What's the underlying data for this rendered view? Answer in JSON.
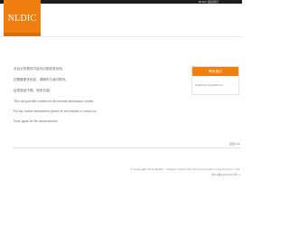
{
  "header": {
    "logo_text": "NLDIC",
    "top_link": "NLDIC 联系我们"
  },
  "messages": [
    "本站点的是供内容为内部信息系统。",
    "如需要更多信息，请随时与我们联系。",
    "给您造成不便，请多包涵！",
    "This site provides content for the internal information system.",
    "For any further information, please do not hesitate to contact us.",
    "Sorry again for the inconvenience."
  ],
  "contact": {
    "title": "联系我们",
    "email": "E-mail:service@nldic.net"
  },
  "back_to_top": "返回TOP",
  "footer": {
    "copyright": "© Copyright 2011 NLDIC - Design: Tianjin Pan Environmental Consulting Co., Ltd.",
    "icp": "津ICP备12000003号-1"
  },
  "colors": {
    "accent": "#f07f10",
    "topbar": "#1e1e1e"
  }
}
